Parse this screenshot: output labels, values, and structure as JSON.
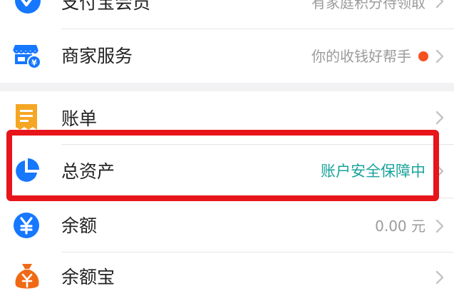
{
  "rows": [
    {
      "id": "alipay-member",
      "label": "支付宝会员",
      "hint": "有家庭积分待领取"
    },
    {
      "id": "merchant",
      "label": "商家服务",
      "hint": "你的收钱好帮手"
    },
    {
      "id": "bill",
      "label": "账单",
      "hint": ""
    },
    {
      "id": "total-assets",
      "label": "总资产",
      "hint": "账户安全保障中"
    },
    {
      "id": "balance",
      "label": "余额",
      "hint": "0.00 元"
    },
    {
      "id": "yuebao",
      "label": "余额宝",
      "hint": ""
    }
  ],
  "colors": {
    "accent_blue": "#1677ff",
    "teal_hint": "#1aa39b",
    "highlight_red": "#e7141a",
    "bill_orange": "#f5a623",
    "yuebao_orange": "#f06a16",
    "notification_dot": "#f4511e"
  },
  "icons": {
    "alipay-member": "alipay-member-icon",
    "merchant": "shop-icon",
    "bill": "bill-icon",
    "total-assets": "pie-chart-icon",
    "balance": "yuan-coin-icon",
    "yuebao": "money-bag-icon"
  }
}
